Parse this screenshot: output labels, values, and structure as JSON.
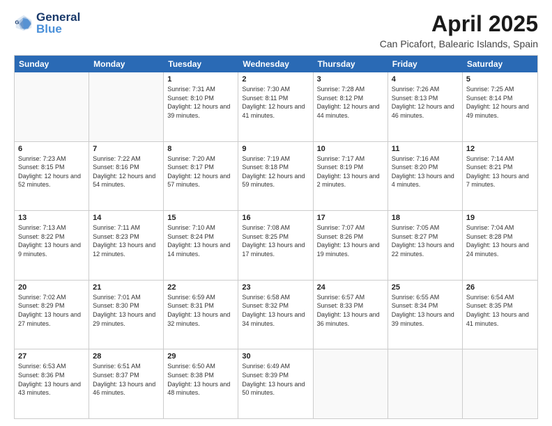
{
  "logo": {
    "text_general": "General",
    "text_blue": "Blue"
  },
  "title": "April 2025",
  "subtitle": "Can Picafort, Balearic Islands, Spain",
  "days_of_week": [
    "Sunday",
    "Monday",
    "Tuesday",
    "Wednesday",
    "Thursday",
    "Friday",
    "Saturday"
  ],
  "weeks": [
    [
      {
        "day": "",
        "sunrise": "",
        "sunset": "",
        "daylight": "",
        "empty": true
      },
      {
        "day": "",
        "sunrise": "",
        "sunset": "",
        "daylight": "",
        "empty": true
      },
      {
        "day": "1",
        "sunrise": "Sunrise: 7:31 AM",
        "sunset": "Sunset: 8:10 PM",
        "daylight": "Daylight: 12 hours and 39 minutes."
      },
      {
        "day": "2",
        "sunrise": "Sunrise: 7:30 AM",
        "sunset": "Sunset: 8:11 PM",
        "daylight": "Daylight: 12 hours and 41 minutes."
      },
      {
        "day": "3",
        "sunrise": "Sunrise: 7:28 AM",
        "sunset": "Sunset: 8:12 PM",
        "daylight": "Daylight: 12 hours and 44 minutes."
      },
      {
        "day": "4",
        "sunrise": "Sunrise: 7:26 AM",
        "sunset": "Sunset: 8:13 PM",
        "daylight": "Daylight: 12 hours and 46 minutes."
      },
      {
        "day": "5",
        "sunrise": "Sunrise: 7:25 AM",
        "sunset": "Sunset: 8:14 PM",
        "daylight": "Daylight: 12 hours and 49 minutes."
      }
    ],
    [
      {
        "day": "6",
        "sunrise": "Sunrise: 7:23 AM",
        "sunset": "Sunset: 8:15 PM",
        "daylight": "Daylight: 12 hours and 52 minutes."
      },
      {
        "day": "7",
        "sunrise": "Sunrise: 7:22 AM",
        "sunset": "Sunset: 8:16 PM",
        "daylight": "Daylight: 12 hours and 54 minutes."
      },
      {
        "day": "8",
        "sunrise": "Sunrise: 7:20 AM",
        "sunset": "Sunset: 8:17 PM",
        "daylight": "Daylight: 12 hours and 57 minutes."
      },
      {
        "day": "9",
        "sunrise": "Sunrise: 7:19 AM",
        "sunset": "Sunset: 8:18 PM",
        "daylight": "Daylight: 12 hours and 59 minutes."
      },
      {
        "day": "10",
        "sunrise": "Sunrise: 7:17 AM",
        "sunset": "Sunset: 8:19 PM",
        "daylight": "Daylight: 13 hours and 2 minutes."
      },
      {
        "day": "11",
        "sunrise": "Sunrise: 7:16 AM",
        "sunset": "Sunset: 8:20 PM",
        "daylight": "Daylight: 13 hours and 4 minutes."
      },
      {
        "day": "12",
        "sunrise": "Sunrise: 7:14 AM",
        "sunset": "Sunset: 8:21 PM",
        "daylight": "Daylight: 13 hours and 7 minutes."
      }
    ],
    [
      {
        "day": "13",
        "sunrise": "Sunrise: 7:13 AM",
        "sunset": "Sunset: 8:22 PM",
        "daylight": "Daylight: 13 hours and 9 minutes."
      },
      {
        "day": "14",
        "sunrise": "Sunrise: 7:11 AM",
        "sunset": "Sunset: 8:23 PM",
        "daylight": "Daylight: 13 hours and 12 minutes."
      },
      {
        "day": "15",
        "sunrise": "Sunrise: 7:10 AM",
        "sunset": "Sunset: 8:24 PM",
        "daylight": "Daylight: 13 hours and 14 minutes."
      },
      {
        "day": "16",
        "sunrise": "Sunrise: 7:08 AM",
        "sunset": "Sunset: 8:25 PM",
        "daylight": "Daylight: 13 hours and 17 minutes."
      },
      {
        "day": "17",
        "sunrise": "Sunrise: 7:07 AM",
        "sunset": "Sunset: 8:26 PM",
        "daylight": "Daylight: 13 hours and 19 minutes."
      },
      {
        "day": "18",
        "sunrise": "Sunrise: 7:05 AM",
        "sunset": "Sunset: 8:27 PM",
        "daylight": "Daylight: 13 hours and 22 minutes."
      },
      {
        "day": "19",
        "sunrise": "Sunrise: 7:04 AM",
        "sunset": "Sunset: 8:28 PM",
        "daylight": "Daylight: 13 hours and 24 minutes."
      }
    ],
    [
      {
        "day": "20",
        "sunrise": "Sunrise: 7:02 AM",
        "sunset": "Sunset: 8:29 PM",
        "daylight": "Daylight: 13 hours and 27 minutes."
      },
      {
        "day": "21",
        "sunrise": "Sunrise: 7:01 AM",
        "sunset": "Sunset: 8:30 PM",
        "daylight": "Daylight: 13 hours and 29 minutes."
      },
      {
        "day": "22",
        "sunrise": "Sunrise: 6:59 AM",
        "sunset": "Sunset: 8:31 PM",
        "daylight": "Daylight: 13 hours and 32 minutes."
      },
      {
        "day": "23",
        "sunrise": "Sunrise: 6:58 AM",
        "sunset": "Sunset: 8:32 PM",
        "daylight": "Daylight: 13 hours and 34 minutes."
      },
      {
        "day": "24",
        "sunrise": "Sunrise: 6:57 AM",
        "sunset": "Sunset: 8:33 PM",
        "daylight": "Daylight: 13 hours and 36 minutes."
      },
      {
        "day": "25",
        "sunrise": "Sunrise: 6:55 AM",
        "sunset": "Sunset: 8:34 PM",
        "daylight": "Daylight: 13 hours and 39 minutes."
      },
      {
        "day": "26",
        "sunrise": "Sunrise: 6:54 AM",
        "sunset": "Sunset: 8:35 PM",
        "daylight": "Daylight: 13 hours and 41 minutes."
      }
    ],
    [
      {
        "day": "27",
        "sunrise": "Sunrise: 6:53 AM",
        "sunset": "Sunset: 8:36 PM",
        "daylight": "Daylight: 13 hours and 43 minutes."
      },
      {
        "day": "28",
        "sunrise": "Sunrise: 6:51 AM",
        "sunset": "Sunset: 8:37 PM",
        "daylight": "Daylight: 13 hours and 46 minutes."
      },
      {
        "day": "29",
        "sunrise": "Sunrise: 6:50 AM",
        "sunset": "Sunset: 8:38 PM",
        "daylight": "Daylight: 13 hours and 48 minutes."
      },
      {
        "day": "30",
        "sunrise": "Sunrise: 6:49 AM",
        "sunset": "Sunset: 8:39 PM",
        "daylight": "Daylight: 13 hours and 50 minutes."
      },
      {
        "day": "",
        "sunrise": "",
        "sunset": "",
        "daylight": "",
        "empty": true
      },
      {
        "day": "",
        "sunrise": "",
        "sunset": "",
        "daylight": "",
        "empty": true
      },
      {
        "day": "",
        "sunrise": "",
        "sunset": "",
        "daylight": "",
        "empty": true
      }
    ]
  ]
}
